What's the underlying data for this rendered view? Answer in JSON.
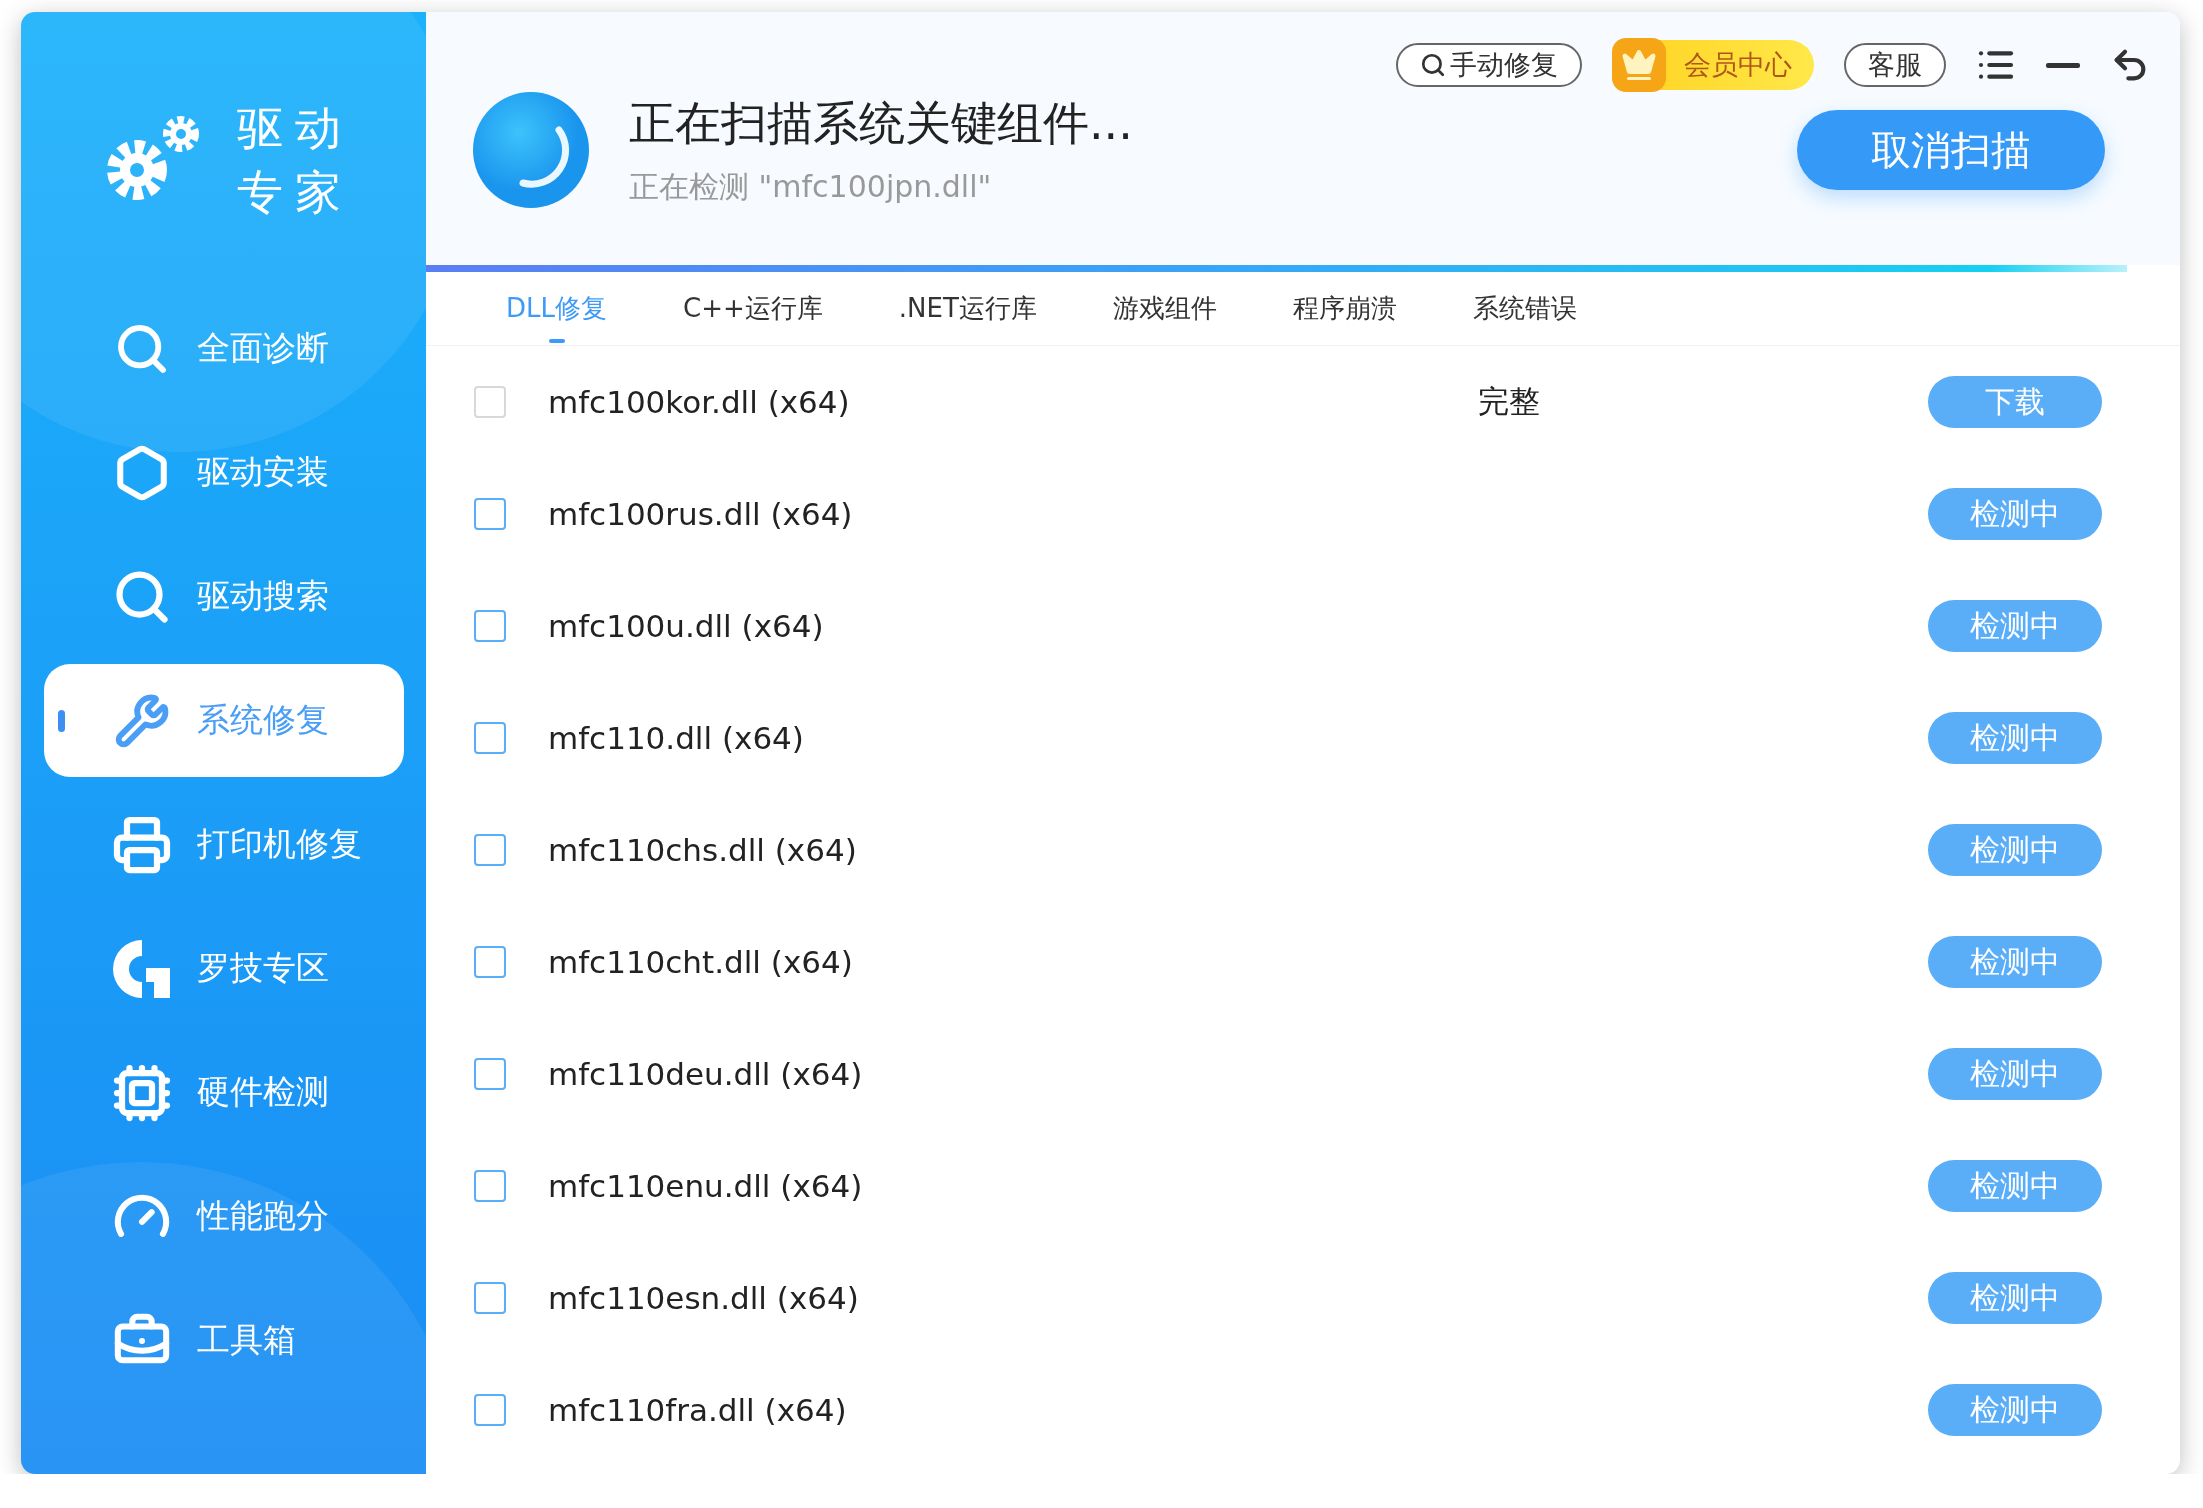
{
  "app": {
    "name_line_1": "驱动",
    "name_line_2": "专家"
  },
  "sidebar": {
    "items": [
      {
        "label": "全面诊断",
        "selected": false
      },
      {
        "label": "驱动安装",
        "selected": false
      },
      {
        "label": "驱动搜索",
        "selected": false
      },
      {
        "label": "系统修复",
        "selected": true
      },
      {
        "label": "打印机修复",
        "selected": false
      },
      {
        "label": "罗技专区",
        "selected": false
      },
      {
        "label": "硬件检测",
        "selected": false
      },
      {
        "label": "性能跑分",
        "selected": false
      },
      {
        "label": "工具箱",
        "selected": false
      }
    ]
  },
  "top_bar": {
    "manual_repair": "手动修复",
    "vip": "会员中心",
    "support": "客服"
  },
  "scan": {
    "title": "正在扫描系统关键组件...",
    "subtitle": "正在检测 \"mfc100jpn.dll\"",
    "cancel": "取消扫描",
    "level": 0.97
  },
  "tabs": [
    {
      "label": "DLL修复",
      "selected": true
    },
    {
      "label": "C++运行库",
      "selected": false
    },
    {
      "label": ".NET运行库",
      "selected": false
    },
    {
      "label": "游戏组件",
      "selected": false
    },
    {
      "label": "程序崩溃",
      "selected": false
    },
    {
      "label": "系统错误",
      "selected": false
    }
  ],
  "rows": [
    {
      "name": "mfc100kor.dll (x64)",
      "disabled": true,
      "status": "完整",
      "action": "下载"
    },
    {
      "name": "mfc100rus.dll (x64)",
      "disabled": false,
      "action": "检测中"
    },
    {
      "name": "mfc100u.dll (x64)",
      "disabled": false,
      "action": "检测中"
    },
    {
      "name": "mfc110.dll (x64)",
      "disabled": false,
      "action": "检测中"
    },
    {
      "name": "mfc110chs.dll (x64)",
      "disabled": false,
      "action": "检测中"
    },
    {
      "name": "mfc110cht.dll (x64)",
      "disabled": false,
      "action": "检测中"
    },
    {
      "name": "mfc110deu.dll (x64)",
      "disabled": false,
      "action": "检测中"
    },
    {
      "name": "mfc110enu.dll (x64)",
      "disabled": false,
      "action": "检测中"
    },
    {
      "name": "mfc110esn.dll (x64)",
      "disabled": false,
      "action": "检测中"
    },
    {
      "name": "mfc110fra.dll (x64)",
      "disabled": false,
      "action": "检测中"
    }
  ]
}
